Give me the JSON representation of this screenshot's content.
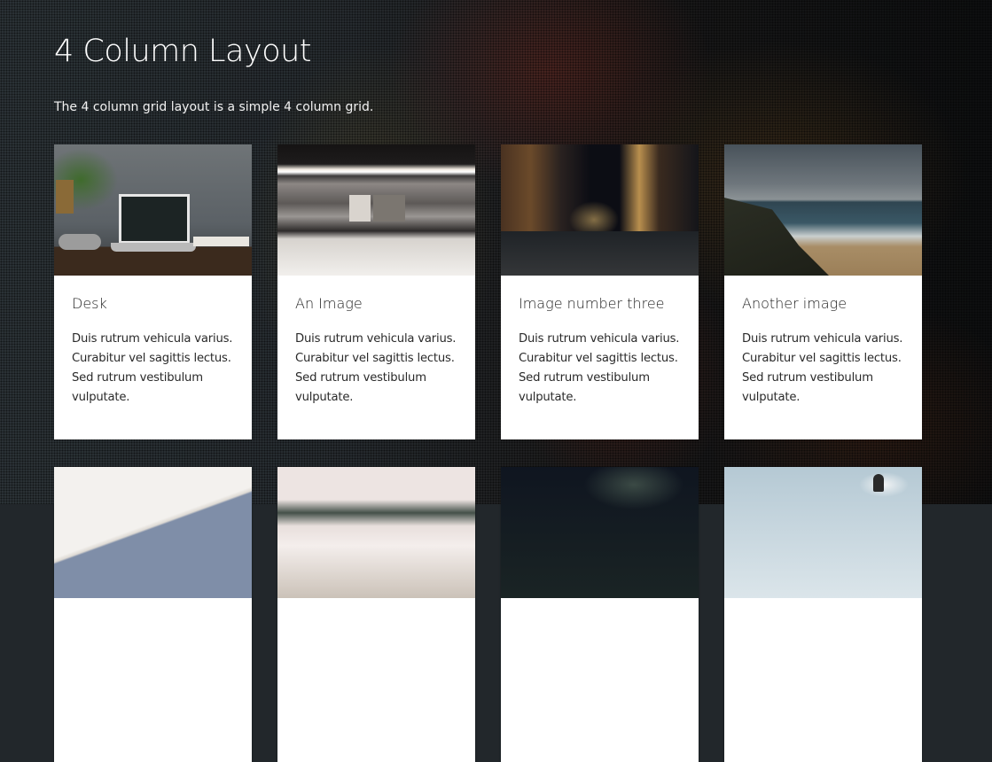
{
  "header": {
    "title": "4 Column Layout",
    "description": "The 4 column grid layout is a simple 4 column grid."
  },
  "cards": [
    {
      "image": "desk-laptop-photo",
      "title": "Desk",
      "text": "Duis rutrum vehicula varius. Curabitur vel sagittis lectus. Sed rutrum vestibulum vulputate."
    },
    {
      "image": "subway-train-motion-blur-photo",
      "title": "An Image",
      "text": "Duis rutrum vehicula varius. Curabitur vel sagittis lectus. Sed rutrum vestibulum vulputate."
    },
    {
      "image": "night-street-photo",
      "title": "Image number three",
      "text": "Duis rutrum vehicula varius. Curabitur vel sagittis lectus. Sed rutrum vestibulum vulputate."
    },
    {
      "image": "stormy-beach-photo",
      "title": "Another image",
      "text": "Duis rutrum vehicula varius. Curabitur vel sagittis lectus. Sed rutrum vestibulum vulputate."
    },
    {
      "image": "white-architecture-photo"
    },
    {
      "image": "coffee-cup-photo"
    },
    {
      "image": "fern-leaves-photo"
    },
    {
      "image": "sky-clouds-photo"
    }
  ]
}
